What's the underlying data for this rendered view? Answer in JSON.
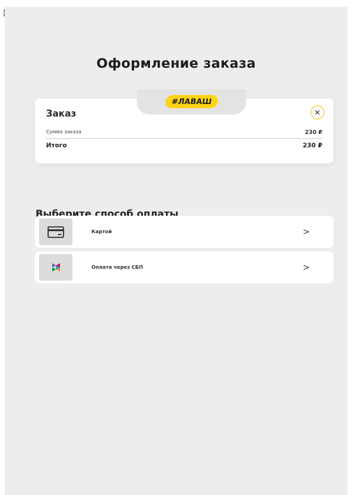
{
  "page": {
    "title": "Оформление заказа"
  },
  "order": {
    "badge": "#ЛАВАШ",
    "label": "Заказ",
    "close_icon": "close-icon",
    "sum_label": "Сумма заказа",
    "sum_value": "230 ₽",
    "total_label": "Итого",
    "total_value": "230 ₽"
  },
  "payment": {
    "title": "Выберите способ оплаты",
    "methods": [
      {
        "label": "Картой",
        "icon": "card-icon",
        "chevron": ">"
      },
      {
        "label": "Оплата через СБП",
        "icon": "sbp-icon",
        "chevron": ">"
      }
    ]
  },
  "colors": {
    "accent_yellow": "#ffd417",
    "background": "#ededed",
    "card": "#ffffff"
  }
}
